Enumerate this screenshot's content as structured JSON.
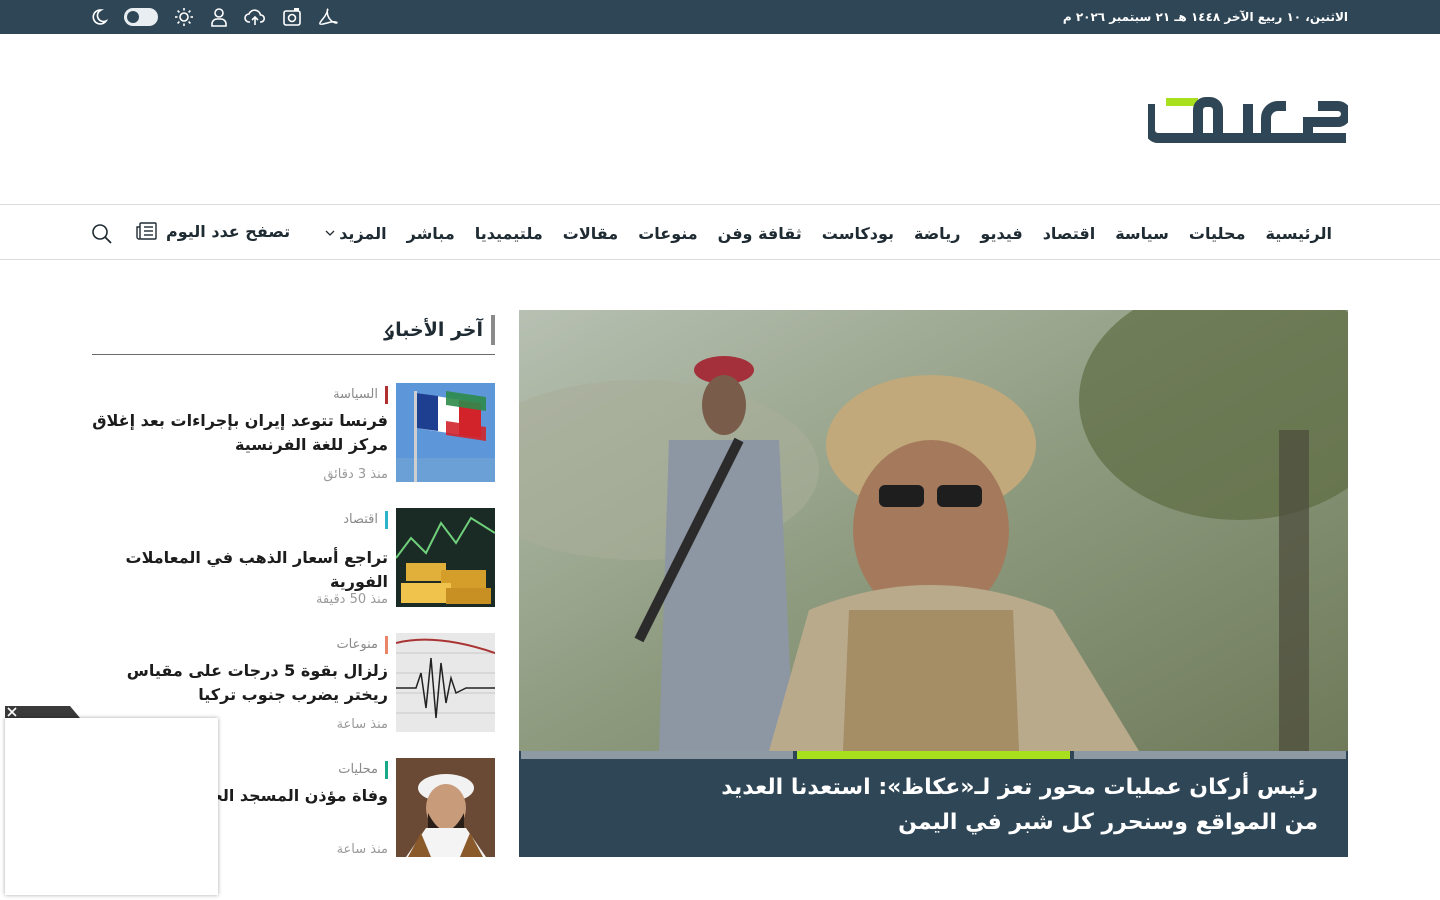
{
  "topbar": {
    "date": "الاثنين، ١٠ ربيع الآخر ١٤٤٨ هـ ٢١ سبتمبر ٢٠٢٦ م",
    "icons": [
      "moon-icon",
      "theme-toggle",
      "sun-icon",
      "user-icon",
      "cloud-icon",
      "photo-icon",
      "pdf-icon"
    ]
  },
  "logo": {
    "text": "عكاظ"
  },
  "nav": {
    "items": [
      "الرئيسية",
      "محليات",
      "سياسة",
      "اقتصاد",
      "فيديو",
      "رياضة",
      "بودكاست",
      "ثقافة وفن",
      "منوعات",
      "مقالات",
      "ملتيميديا",
      "مباشر"
    ],
    "more": "المزيد",
    "browse": "تصفح عدد اليوم"
  },
  "hero": {
    "headline": "رئيس أركان عمليات محور تعز لـ«عكاظ»: استعدنا العديد من المواقع وسنحرر كل شبر في اليمن",
    "slides_total": 3,
    "active_slide": 2
  },
  "latest": {
    "title": "آخر الأخبار",
    "items": [
      {
        "category": "السياسة",
        "category_color": "#b03030",
        "title": "فرنسا تتوعد إيران بإجراءات بعد إغلاق مركز للغة الفرنسية",
        "time": "منذ 3 دقائق"
      },
      {
        "category": "اقتصاد",
        "category_color": "#2ab3c9",
        "title": "تراجع أسعار الذهب في المعاملات الفورية",
        "time": "منذ 50 دقيقة"
      },
      {
        "category": "منوعات",
        "category_color": "#e9866a",
        "title": "زلزال بقوة 5 درجات على مقياس ريختر يضرب جنوب تركيا",
        "time": "منذ ساعة"
      },
      {
        "category": "محليات",
        "category_color": "#1aa88a",
        "title": "وفاة مؤذن المسجد الحرام المدني",
        "time": "منذ ساعة"
      }
    ]
  },
  "colors": {
    "topbar": "#2f4656",
    "accent": "#a8e01e"
  }
}
